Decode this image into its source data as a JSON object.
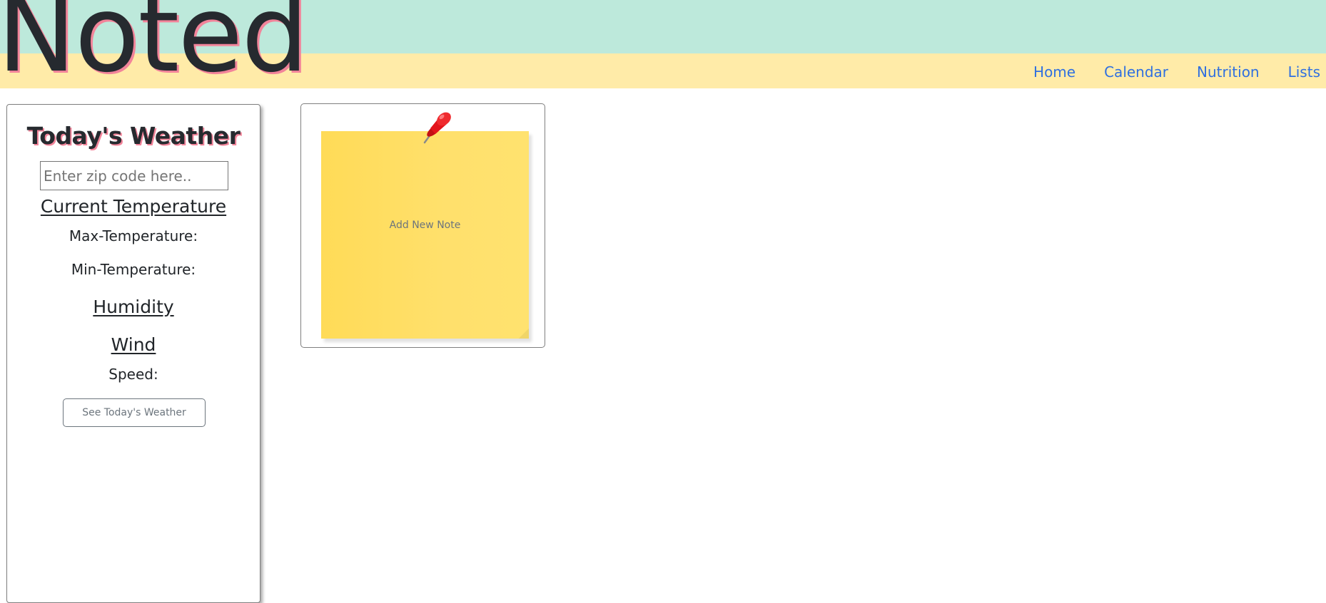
{
  "header": {
    "brand": "Noted",
    "nav": [
      "Home",
      "Calendar",
      "Nutrition",
      "Lists"
    ]
  },
  "weather": {
    "title": "Today's Weather",
    "zip_placeholder": "Enter zip code here..",
    "current_temperature": "Current Temperature",
    "max_temperature": "Max-Temperature:",
    "min_temperature": "Min-Temperature:",
    "humidity": "Humidity",
    "wind": "Wind",
    "speed": "Speed:",
    "button": "See Today's Weather"
  },
  "note": {
    "label": "Add New Note",
    "icon": "pushpin-icon"
  },
  "colors": {
    "header_top": "#bde9db",
    "header_bottom": "#ffeba8",
    "nav_link": "#2f6fe0",
    "title_shadow": "#f2849a",
    "sticky_note": "#ffdb57"
  }
}
